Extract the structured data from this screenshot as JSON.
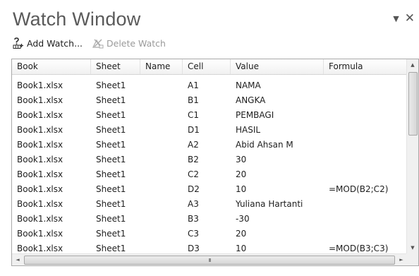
{
  "window": {
    "title": "Watch Window",
    "dropdown_glyph": "▼",
    "close_glyph": "✕"
  },
  "toolbar": {
    "add_watch": "Add Watch...",
    "add_watch_icon": "add-watch-icon",
    "delete_watch": "Delete Watch",
    "delete_watch_icon": "delete-watch-icon"
  },
  "grid": {
    "columns": [
      "Book",
      "Sheet",
      "Name",
      "Cell",
      "Value",
      "Formula"
    ],
    "rows": [
      {
        "book": "Book1.xlsx",
        "sheet": "Sheet1",
        "name": "",
        "cell": "A1",
        "value": "NAMA",
        "formula": ""
      },
      {
        "book": "Book1.xlsx",
        "sheet": "Sheet1",
        "name": "",
        "cell": "B1",
        "value": "ANGKA",
        "formula": ""
      },
      {
        "book": "Book1.xlsx",
        "sheet": "Sheet1",
        "name": "",
        "cell": "C1",
        "value": "PEMBAGI",
        "formula": ""
      },
      {
        "book": "Book1.xlsx",
        "sheet": "Sheet1",
        "name": "",
        "cell": "D1",
        "value": "HASIL",
        "formula": ""
      },
      {
        "book": "Book1.xlsx",
        "sheet": "Sheet1",
        "name": "",
        "cell": "A2",
        "value": "Abid Ahsan M",
        "formula": ""
      },
      {
        "book": "Book1.xlsx",
        "sheet": "Sheet1",
        "name": "",
        "cell": "B2",
        "value": "30",
        "formula": ""
      },
      {
        "book": "Book1.xlsx",
        "sheet": "Sheet1",
        "name": "",
        "cell": "C2",
        "value": "20",
        "formula": ""
      },
      {
        "book": "Book1.xlsx",
        "sheet": "Sheet1",
        "name": "",
        "cell": "D2",
        "value": "10",
        "formula": "=MOD(B2;C2)"
      },
      {
        "book": "Book1.xlsx",
        "sheet": "Sheet1",
        "name": "",
        "cell": "A3",
        "value": "Yuliana Hartanti",
        "formula": ""
      },
      {
        "book": "Book1.xlsx",
        "sheet": "Sheet1",
        "name": "",
        "cell": "B3",
        "value": "-30",
        "formula": ""
      },
      {
        "book": "Book1.xlsx",
        "sheet": "Sheet1",
        "name": "",
        "cell": "C3",
        "value": "20",
        "formula": ""
      },
      {
        "book": "Book1.xlsx",
        "sheet": "Sheet1",
        "name": "",
        "cell": "D3",
        "value": "10",
        "formula": "=MOD(B3;C3)"
      }
    ]
  },
  "scrollbars": {
    "up_glyph": "▲",
    "down_glyph": "▼",
    "left_glyph": "◄",
    "right_glyph": "►",
    "grip_glyph": "III"
  },
  "colors": {
    "title_text": "#5a5a5a",
    "disabled_text": "#9a9a9a",
    "grid_border": "#a9a9a9"
  }
}
